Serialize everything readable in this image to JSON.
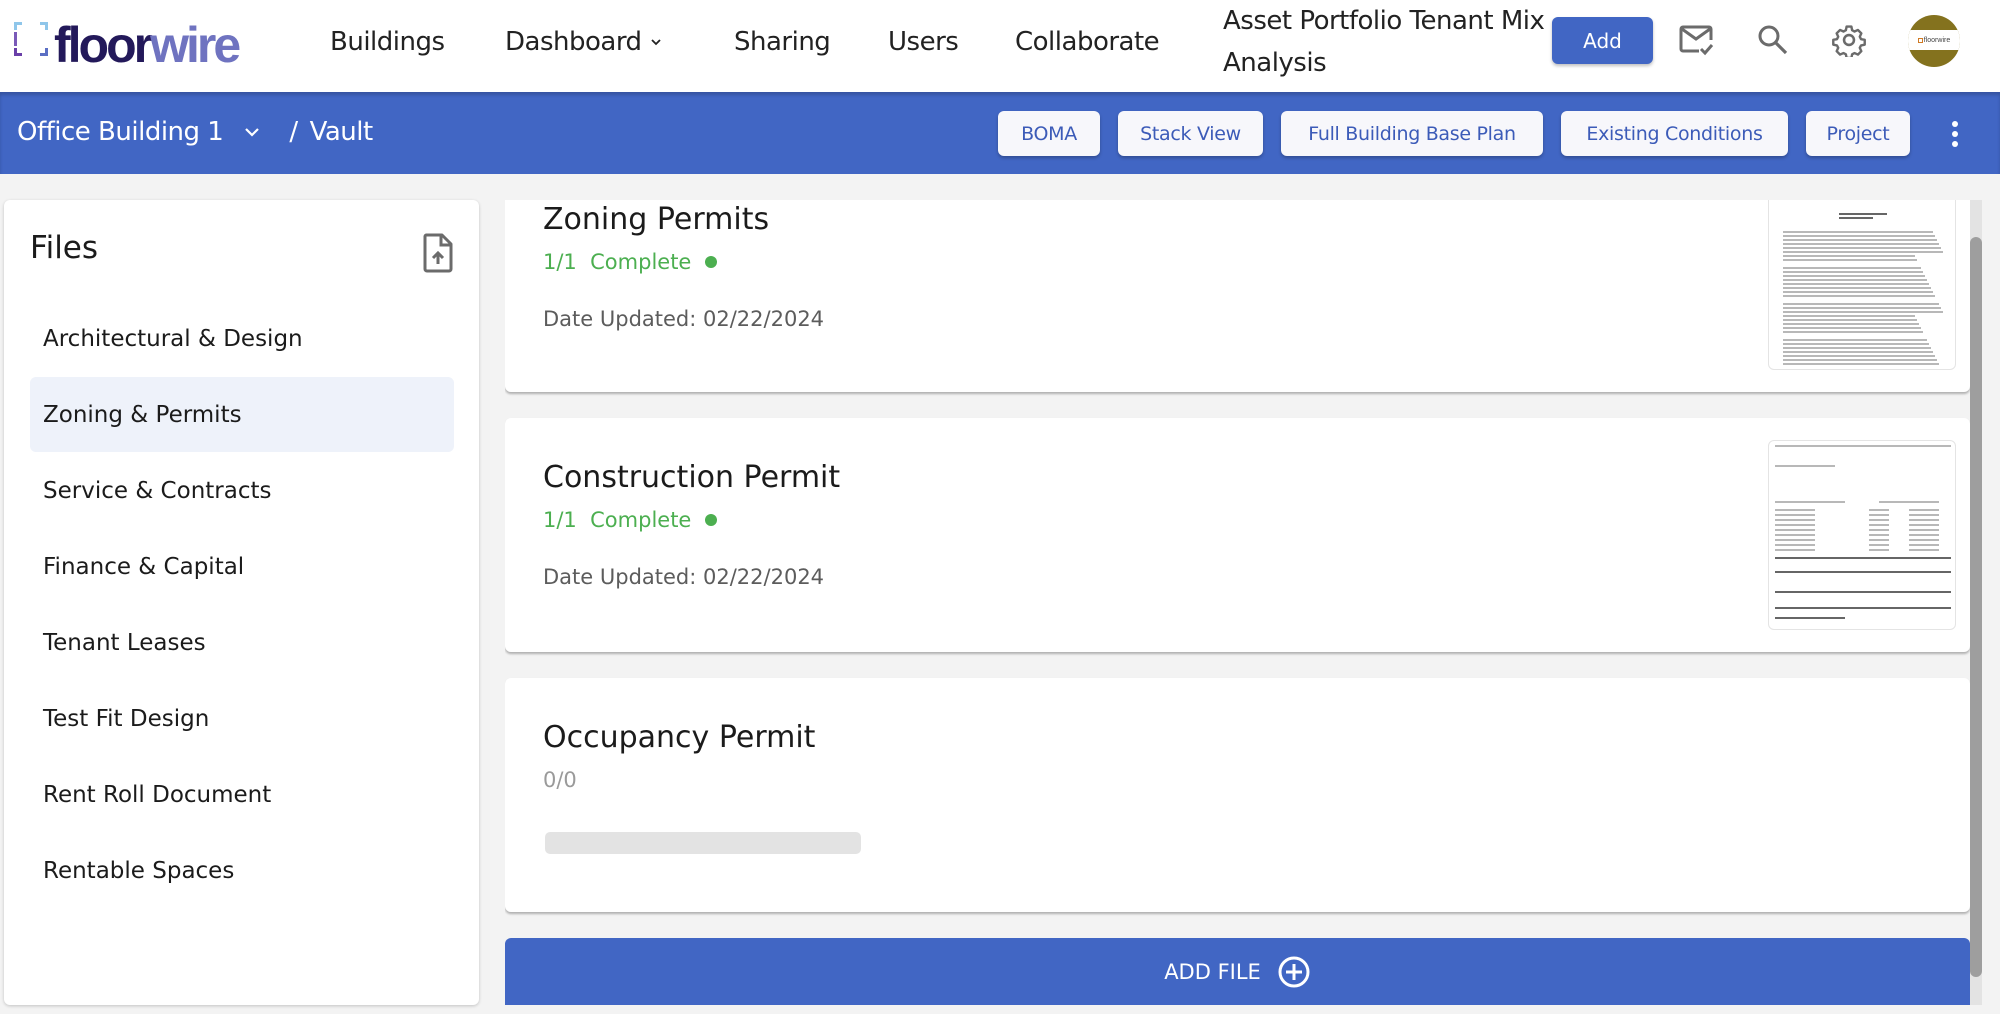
{
  "brand": {
    "part1": "floor",
    "part2": "wire"
  },
  "nav": {
    "items": [
      {
        "label": "Buildings"
      },
      {
        "label": "Dashboard",
        "has_dropdown": true
      },
      {
        "label": "Sharing"
      },
      {
        "label": "Users"
      },
      {
        "label": "Collaborate"
      }
    ],
    "title": "Asset Portfolio Tenant Mix Analysis",
    "add_label": "Add",
    "icons": [
      "mail-check-icon",
      "search-icon",
      "gear-icon"
    ],
    "avatar_text": "floorwire"
  },
  "subbar": {
    "building": "Office Building 1",
    "separator": "/",
    "page": "Vault",
    "buttons": [
      {
        "label": "BOMA"
      },
      {
        "label": "Stack View"
      },
      {
        "label": "Full Building Base Plan"
      },
      {
        "label": "Existing Conditions"
      },
      {
        "label": "Project"
      }
    ]
  },
  "sidebar": {
    "title": "Files",
    "items": [
      {
        "label": "Architectural & Design",
        "active": false
      },
      {
        "label": "Zoning & Permits",
        "active": true
      },
      {
        "label": "Service & Contracts",
        "active": false
      },
      {
        "label": "Finance & Capital",
        "active": false
      },
      {
        "label": "Tenant Leases",
        "active": false
      },
      {
        "label": "Test Fit Design",
        "active": false
      },
      {
        "label": "Rent Roll Document",
        "active": false
      },
      {
        "label": "Rentable Spaces",
        "active": false
      }
    ]
  },
  "files": [
    {
      "title": "Zoning Permits",
      "status": "1/1  Complete",
      "complete": true,
      "date": "Date Updated: 02/22/2024",
      "has_thumbnail": true
    },
    {
      "title": "Construction Permit",
      "status": "1/1  Complete",
      "complete": true,
      "date": "Date Updated: 02/22/2024",
      "has_thumbnail": true
    },
    {
      "title": "Occupancy Permit",
      "status": "0/0",
      "complete": false,
      "date": null,
      "has_thumbnail": false,
      "progress": 0
    }
  ],
  "add_file_label": "ADD FILE",
  "colors": {
    "primary": "#4166c4",
    "complete": "#4caf50",
    "active_item": "#eef2fa"
  }
}
